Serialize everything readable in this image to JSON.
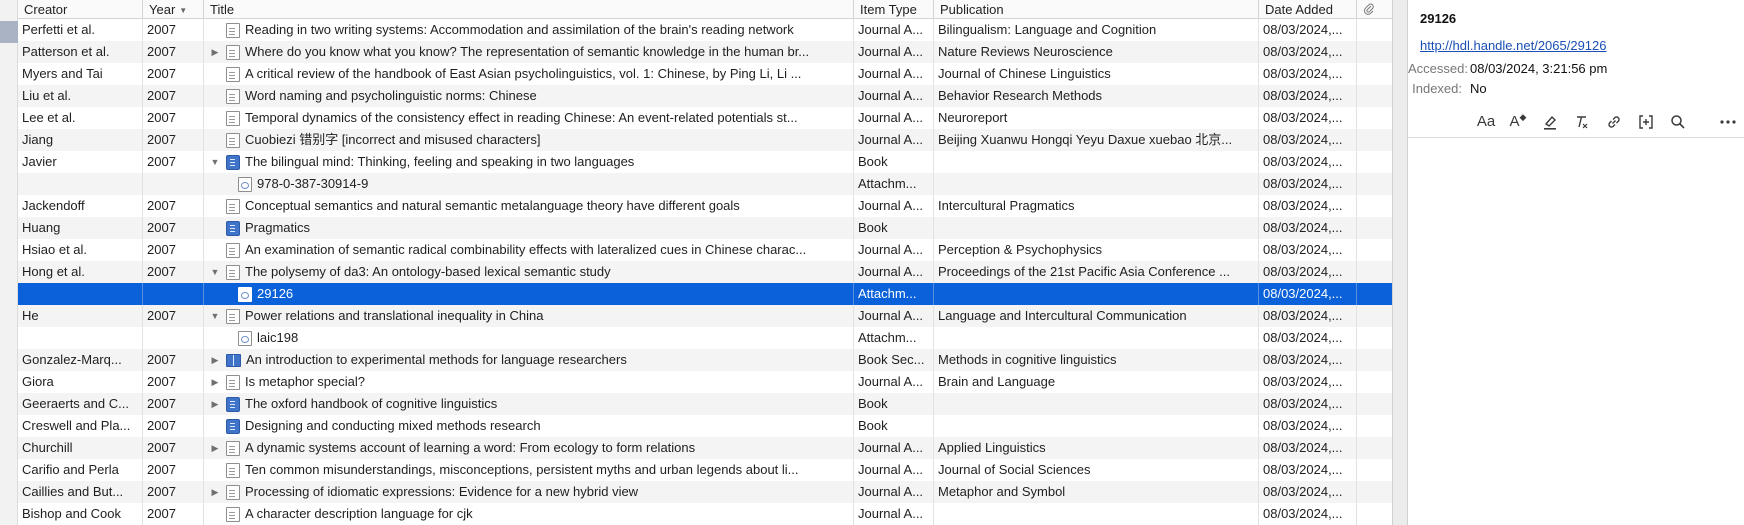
{
  "columns": {
    "creator": "Creator",
    "year": "Year",
    "title": "Title",
    "item_type": "Item Type",
    "publication": "Publication",
    "date_added": "Date Added"
  },
  "rows": [
    {
      "creator": "Perfetti et al.",
      "year": "2007",
      "twisty": "",
      "icon": "document",
      "child": false,
      "title": "Reading in two writing systems: Accommodation and assimilation of the brain's reading network",
      "type": "Journal A...",
      "publication": "Bilingualism: Language and Cognition",
      "date": "08/03/2024,..."
    },
    {
      "creator": "Patterson et al.",
      "year": "2007",
      "twisty": "collapsed",
      "icon": "document",
      "child": false,
      "title": "Where do you know what you know? The representation of semantic knowledge in the human br...",
      "type": "Journal A...",
      "publication": "Nature Reviews Neuroscience",
      "date": "08/03/2024,..."
    },
    {
      "creator": "Myers and Tai",
      "year": "2007",
      "twisty": "",
      "icon": "document",
      "child": false,
      "title": "A critical review of the handbook of East Asian psycholinguistics, vol. 1: Chinese, by Ping Li, Li ...",
      "type": "Journal A...",
      "publication": "Journal of Chinese Linguistics",
      "date": "08/03/2024,..."
    },
    {
      "creator": "Liu et al.",
      "year": "2007",
      "twisty": "",
      "icon": "document",
      "child": false,
      "title": "Word naming and psycholinguistic norms: Chinese",
      "type": "Journal A...",
      "publication": "Behavior Research Methods",
      "date": "08/03/2024,..."
    },
    {
      "creator": "Lee et al.",
      "year": "2007",
      "twisty": "",
      "icon": "document",
      "child": false,
      "title": "Temporal dynamics of the consistency effect in reading Chinese: An event-related potentials st...",
      "type": "Journal A...",
      "publication": "Neuroreport",
      "date": "08/03/2024,..."
    },
    {
      "creator": "Jiang",
      "year": "2007",
      "twisty": "",
      "icon": "document",
      "child": false,
      "title": "Cuobiezi 错别字 [incorrect and misused characters]",
      "type": "Journal A...",
      "publication": "Beijing Xuanwu Hongqi Yeyu Daxue xuebao 北京...",
      "date": "08/03/2024,..."
    },
    {
      "creator": "Javier",
      "year": "2007",
      "twisty": "expanded",
      "icon": "book",
      "child": false,
      "title": "The bilingual mind: Thinking, feeling and speaking in two languages",
      "type": "Book",
      "publication": "",
      "date": "08/03/2024,..."
    },
    {
      "creator": "",
      "year": "",
      "twisty": "",
      "icon": "web",
      "child": true,
      "title": "978-0-387-30914-9",
      "type": "Attachm...",
      "publication": "",
      "date": "08/03/2024,..."
    },
    {
      "creator": "Jackendoff",
      "year": "2007",
      "twisty": "",
      "icon": "document",
      "child": false,
      "title": "Conceptual semantics and natural semantic metalanguage theory have different goals",
      "type": "Journal A...",
      "publication": "Intercultural Pragmatics",
      "date": "08/03/2024,..."
    },
    {
      "creator": "Huang",
      "year": "2007",
      "twisty": "",
      "icon": "book",
      "child": false,
      "title": "Pragmatics",
      "type": "Book",
      "publication": "",
      "date": "08/03/2024,..."
    },
    {
      "creator": "Hsiao et al.",
      "year": "2007",
      "twisty": "",
      "icon": "document",
      "child": false,
      "title": "An examination of semantic radical combinability effects with lateralized cues in Chinese charac...",
      "type": "Journal A...",
      "publication": "Perception & Psychophysics",
      "date": "08/03/2024,..."
    },
    {
      "creator": "Hong et al.",
      "year": "2007",
      "twisty": "expanded",
      "icon": "document",
      "child": false,
      "title": "The polysemy of da3: An ontology-based lexical semantic study",
      "type": "Journal A...",
      "publication": "Proceedings of the 21st Pacific Asia Conference ...",
      "date": "08/03/2024,..."
    },
    {
      "creator": "",
      "year": "",
      "twisty": "",
      "icon": "web",
      "child": true,
      "selected": true,
      "title": "29126",
      "type": "Attachm...",
      "publication": "",
      "date": "08/03/2024,..."
    },
    {
      "creator": "He",
      "year": "2007",
      "twisty": "expanded",
      "icon": "document",
      "child": false,
      "title": "Power relations and translational inequality in China",
      "type": "Journal A...",
      "publication": "Language and Intercultural Communication",
      "date": "08/03/2024,..."
    },
    {
      "creator": "",
      "year": "",
      "twisty": "",
      "icon": "web",
      "child": true,
      "title": "laic198",
      "type": "Attachm...",
      "publication": "",
      "date": "08/03/2024,..."
    },
    {
      "creator": "Gonzalez-Marq...",
      "year": "2007",
      "twisty": "collapsed",
      "icon": "section",
      "child": false,
      "title": "An introduction to experimental methods for language researchers",
      "type": "Book Sec...",
      "publication": "Methods in cognitive linguistics",
      "date": "08/03/2024,..."
    },
    {
      "creator": "Giora",
      "year": "2007",
      "twisty": "collapsed",
      "icon": "document",
      "child": false,
      "title": "Is metaphor special?",
      "type": "Journal A...",
      "publication": "Brain and Language",
      "date": "08/03/2024,..."
    },
    {
      "creator": "Geeraerts and C...",
      "year": "2007",
      "twisty": "collapsed",
      "icon": "book",
      "child": false,
      "title": "The oxford handbook of cognitive linguistics",
      "type": "Book",
      "publication": "",
      "date": "08/03/2024,..."
    },
    {
      "creator": "Creswell and Pla...",
      "year": "2007",
      "twisty": "",
      "icon": "book",
      "child": false,
      "title": "Designing and conducting mixed methods research",
      "type": "Book",
      "publication": "",
      "date": "08/03/2024,..."
    },
    {
      "creator": "Churchill",
      "year": "2007",
      "twisty": "collapsed",
      "icon": "document",
      "child": false,
      "title": "A dynamic systems account of learning a word: From ecology to form relations",
      "type": "Journal A...",
      "publication": "Applied Linguistics",
      "date": "08/03/2024,..."
    },
    {
      "creator": "Carifio and Perla",
      "year": "2007",
      "twisty": "",
      "icon": "document",
      "child": false,
      "title": "Ten common misunderstandings, misconceptions, persistent myths and urban legends about li...",
      "type": "Journal A...",
      "publication": "Journal of Social Sciences",
      "date": "08/03/2024,..."
    },
    {
      "creator": "Caillies and But...",
      "year": "2007",
      "twisty": "collapsed",
      "icon": "document",
      "child": false,
      "title": "Processing of idiomatic expressions: Evidence for a new hybrid view",
      "type": "Journal A...",
      "publication": "Metaphor and Symbol",
      "date": "08/03/2024,..."
    },
    {
      "creator": "Bishop and Cook",
      "year": "2007",
      "twisty": "",
      "icon": "document",
      "child": false,
      "title": "A character description language for cjk",
      "type": "Journal A...",
      "publication": "",
      "date": "08/03/2024,..."
    }
  ],
  "side": {
    "title": "29126",
    "url": "http://hdl.handle.net/2065/29126",
    "accessed_label": "Accessed:",
    "accessed_value": "08/03/2024, 3:21:56 pm",
    "indexed_label": "Indexed:",
    "indexed_value": "No"
  },
  "toolbar": {
    "text_format": "Aa",
    "text_color": "A"
  },
  "colors": {
    "selection": "#0a61d9",
    "link": "#1a4fb5"
  }
}
